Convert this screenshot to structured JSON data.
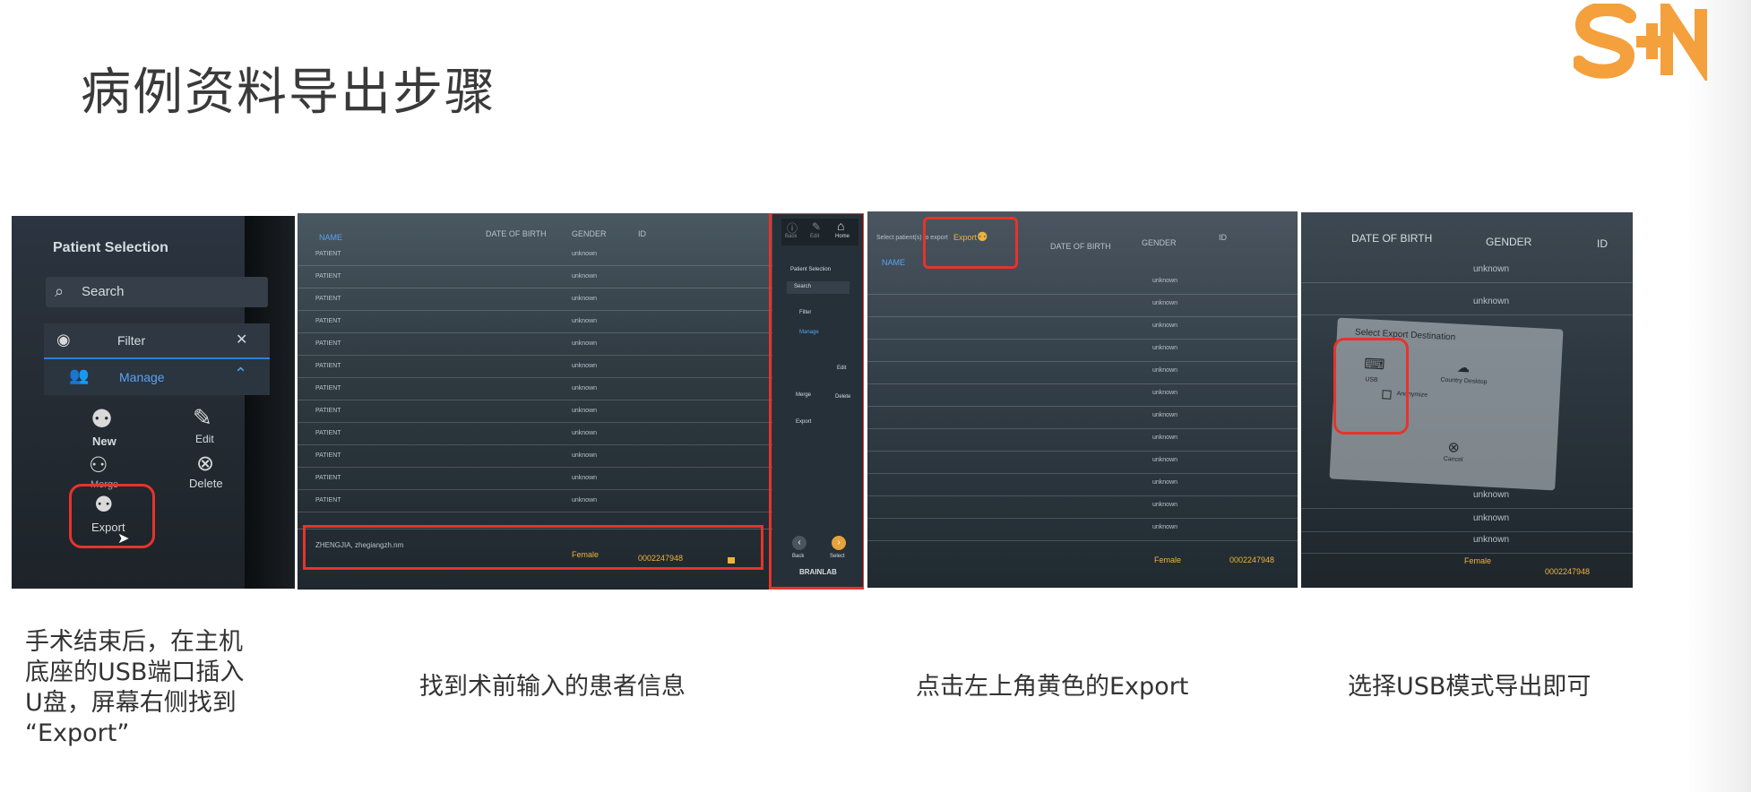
{
  "title": "病例资料导出步骤",
  "brand": {
    "accent": "#f4a03c",
    "logo_text": "S+N"
  },
  "panel1": {
    "heading": "Patient Selection",
    "search_label": "Search",
    "filter_label": "Filter",
    "manage_label": "Manage",
    "actions": {
      "new": "New",
      "edit": "Edit",
      "merge": "Merge",
      "delete": "Delete",
      "export": "Export"
    }
  },
  "panel2": {
    "table_headers": [
      "NAME",
      "DATE OF BIRTH",
      "GENDER",
      "ID"
    ],
    "rows": [
      {
        "name": "PATIENT",
        "gender": "unknown"
      },
      {
        "name": "PATIENT",
        "gender": "unknown"
      },
      {
        "name": "PATIENT",
        "gender": "unknown"
      },
      {
        "name": "PATIENT",
        "gender": "unknown"
      },
      {
        "name": "PATIENT",
        "gender": "unknown"
      },
      {
        "name": "PATIENT",
        "gender": "unknown"
      },
      {
        "name": "PATIENT",
        "gender": "unknown"
      },
      {
        "name": "PATIENT",
        "gender": "unknown"
      },
      {
        "name": "PATIENT",
        "gender": "unknown"
      },
      {
        "name": "PATIENT",
        "gender": "unknown"
      },
      {
        "name": "PATIENT",
        "gender": "unknown"
      },
      {
        "name": "PATIENT",
        "gender": "unknown"
      }
    ],
    "selected_row": {
      "name": "ZHENGJIA, zhegiangzh.nm",
      "gender": "Female",
      "id": "0002247948"
    },
    "sidebar": {
      "top_icons": [
        "Back",
        "Edit",
        "Home"
      ],
      "heading": "Patient Selection",
      "search_label": "Search",
      "filter_label": "Filter",
      "manage_label": "Manage",
      "actions": [
        "Edit",
        "Merge",
        "Delete",
        "Export"
      ],
      "nav": [
        "Back",
        "Select"
      ],
      "brand": "BRAINLAB"
    }
  },
  "panel3": {
    "select_label": "Select patient(s) to export",
    "export_label": "Export",
    "table_headers": [
      "NAME",
      "DATE OF BIRTH",
      "GENDER",
      "ID"
    ],
    "row_gender": "unknown",
    "selected_gender": "Female",
    "selected_id": "0002247948"
  },
  "panel4": {
    "table_headers": [
      "DATE OF BIRTH",
      "GENDER",
      "ID"
    ],
    "dialog_title": "Select Export Destination",
    "options": {
      "usb": "USB",
      "country": "Country Desktop",
      "anonymize": "Anonymize",
      "cancel": "Cancel"
    },
    "row_gender": "unknown",
    "selected_gender": "Female",
    "selected_id": "0002247948"
  },
  "captions": [
    "手术结束后，在主机\n底座的USB端口插入\nU盘，屏幕右侧找到\n“Export”",
    "找到术前输入的患者信息",
    "点击左上角黄色的Export",
    "选择USB模式导出即可"
  ]
}
